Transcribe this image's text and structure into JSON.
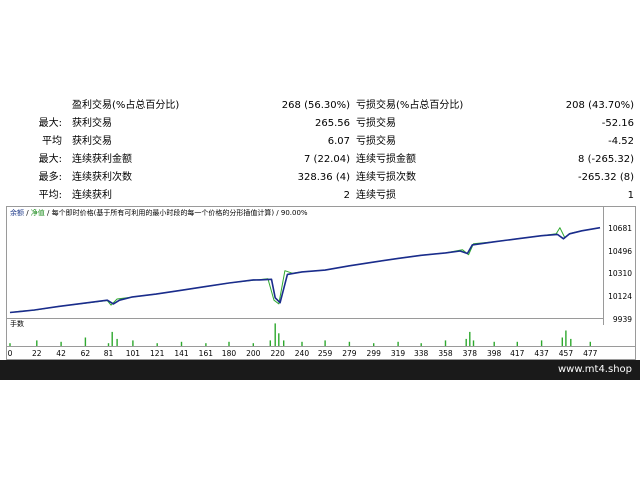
{
  "stats": {
    "rows": [
      {
        "label": "",
        "name": "盈利交易(%占总百分比)",
        "value": "268 (56.30%)",
        "name2": "亏损交易(%占总百分比)",
        "value2": "208 (43.70%)"
      },
      {
        "label": "最大:",
        "name": "获利交易",
        "value": "265.56",
        "name2": "亏损交易",
        "value2": "-52.16"
      },
      {
        "label": "平均",
        "name": "获利交易",
        "value": "6.07",
        "name2": "亏损交易",
        "value2": "-4.52"
      },
      {
        "label": "最大:",
        "name": "连续获利金额",
        "value": "7 (22.04)",
        "name2": "连续亏损金额",
        "value2": "8 (-265.32)"
      },
      {
        "label": "最多:",
        "name": "连续获利次数",
        "value": "328.36 (4)",
        "name2": "连续亏损次数",
        "value2": "-265.32 (8)"
      },
      {
        "label": "平均:",
        "name": "连续获利",
        "value": "2",
        "name2": "连续亏损",
        "value2": "1"
      }
    ]
  },
  "chart": {
    "legend": {
      "balance": "余额",
      "sep1": " / ",
      "equity": "净值",
      "sep2": " / ",
      "desc": "每个即时价格(基于所有可利用的最小时段的每一个价格的分形插值计算) / 90.00%"
    },
    "volume_label": "手数",
    "colors": {
      "balance": "#1a2c8c",
      "equity": "#2ea82e",
      "volume": "#2ea82e"
    }
  },
  "chart_data": {
    "type": "line",
    "x_ticks": [
      "0",
      "22",
      "42",
      "62",
      "81",
      "101",
      "121",
      "141",
      "161",
      "180",
      "200",
      "220",
      "240",
      "259",
      "279",
      "299",
      "319",
      "338",
      "358",
      "378",
      "398",
      "417",
      "437",
      "457",
      "477"
    ],
    "y_ticks": [
      10681,
      10496,
      10310,
      10124,
      9939
    ],
    "ylim": [
      9939,
      10720
    ],
    "xlim": [
      0,
      485
    ],
    "series": [
      {
        "name": "余额",
        "points": [
          [
            0,
            10000
          ],
          [
            10,
            10010
          ],
          [
            20,
            10020
          ],
          [
            40,
            10050
          ],
          [
            60,
            10075
          ],
          [
            80,
            10100
          ],
          [
            85,
            10070
          ],
          [
            90,
            10100
          ],
          [
            100,
            10125
          ],
          [
            120,
            10150
          ],
          [
            140,
            10180
          ],
          [
            160,
            10210
          ],
          [
            180,
            10240
          ],
          [
            200,
            10265
          ],
          [
            205,
            10265
          ],
          [
            215,
            10270
          ],
          [
            218,
            10120
          ],
          [
            222,
            10080
          ],
          [
            228,
            10310
          ],
          [
            240,
            10330
          ],
          [
            259,
            10345
          ],
          [
            279,
            10380
          ],
          [
            299,
            10410
          ],
          [
            319,
            10440
          ],
          [
            338,
            10465
          ],
          [
            358,
            10485
          ],
          [
            370,
            10500
          ],
          [
            376,
            10480
          ],
          [
            380,
            10550
          ],
          [
            398,
            10575
          ],
          [
            417,
            10600
          ],
          [
            437,
            10625
          ],
          [
            450,
            10635
          ],
          [
            455,
            10600
          ],
          [
            460,
            10640
          ],
          [
            470,
            10665
          ],
          [
            485,
            10690
          ]
        ]
      },
      {
        "name": "净值",
        "points": [
          [
            0,
            10000
          ],
          [
            10,
            10012
          ],
          [
            20,
            10018
          ],
          [
            40,
            10050
          ],
          [
            60,
            10073
          ],
          [
            80,
            10098
          ],
          [
            83,
            10060
          ],
          [
            88,
            10110
          ],
          [
            100,
            10125
          ],
          [
            120,
            10150
          ],
          [
            140,
            10180
          ],
          [
            160,
            10210
          ],
          [
            180,
            10240
          ],
          [
            200,
            10262
          ],
          [
            212,
            10275
          ],
          [
            217,
            10100
          ],
          [
            221,
            10070
          ],
          [
            226,
            10340
          ],
          [
            232,
            10320
          ],
          [
            240,
            10330
          ],
          [
            259,
            10345
          ],
          [
            279,
            10380
          ],
          [
            299,
            10410
          ],
          [
            319,
            10440
          ],
          [
            338,
            10465
          ],
          [
            358,
            10485
          ],
          [
            372,
            10510
          ],
          [
            377,
            10470
          ],
          [
            381,
            10560
          ],
          [
            398,
            10575
          ],
          [
            417,
            10600
          ],
          [
            437,
            10625
          ],
          [
            449,
            10640
          ],
          [
            452,
            10690
          ],
          [
            456,
            10610
          ],
          [
            461,
            10645
          ],
          [
            470,
            10665
          ],
          [
            485,
            10690
          ]
        ]
      }
    ],
    "volume": [
      [
        0,
        0.2
      ],
      [
        22,
        0.4
      ],
      [
        42,
        0.3
      ],
      [
        62,
        0.6
      ],
      [
        81,
        0.2
      ],
      [
        84,
        1.0
      ],
      [
        88,
        0.5
      ],
      [
        101,
        0.4
      ],
      [
        121,
        0.2
      ],
      [
        141,
        0.3
      ],
      [
        161,
        0.2
      ],
      [
        180,
        0.3
      ],
      [
        200,
        0.2
      ],
      [
        214,
        0.4
      ],
      [
        218,
        1.6
      ],
      [
        221,
        0.9
      ],
      [
        225,
        0.4
      ],
      [
        240,
        0.3
      ],
      [
        259,
        0.4
      ],
      [
        279,
        0.3
      ],
      [
        299,
        0.2
      ],
      [
        319,
        0.3
      ],
      [
        338,
        0.2
      ],
      [
        358,
        0.4
      ],
      [
        375,
        0.5
      ],
      [
        378,
        1.0
      ],
      [
        381,
        0.4
      ],
      [
        398,
        0.3
      ],
      [
        417,
        0.3
      ],
      [
        437,
        0.4
      ],
      [
        454,
        0.6
      ],
      [
        457,
        1.1
      ],
      [
        461,
        0.5
      ],
      [
        477,
        0.3
      ]
    ]
  },
  "footer": {
    "site": "www.mt4.shop"
  }
}
